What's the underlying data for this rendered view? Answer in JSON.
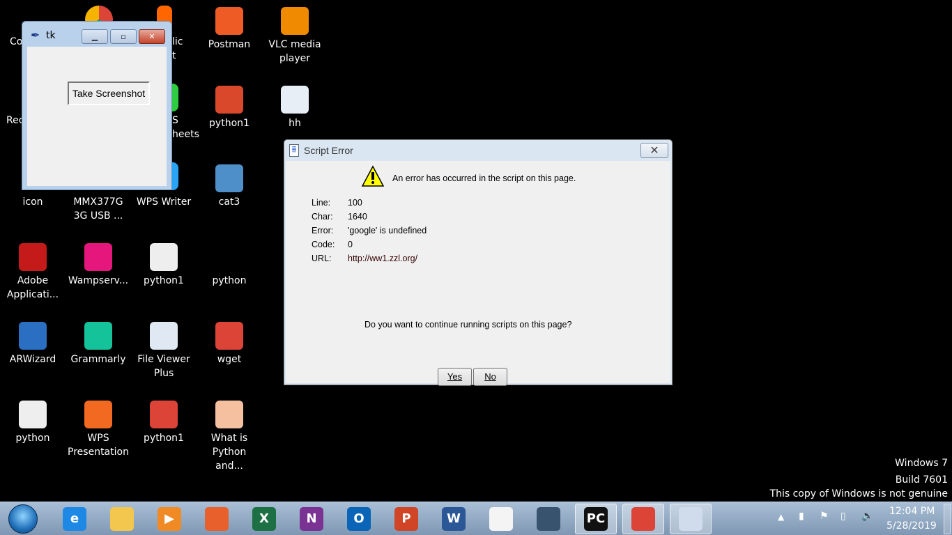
{
  "desktop": {
    "icons": [
      {
        "label": "Postman",
        "color": "#ef5b25",
        "col": 3,
        "row": 0
      },
      {
        "label": "VLC media player",
        "color": "#f08a00",
        "col": 4,
        "row": 0
      },
      {
        "label": "python1",
        "color": "#d9482b",
        "col": 3,
        "row": 1
      },
      {
        "label": "hh",
        "color": "#e8eef6",
        "col": 4,
        "row": 1
      },
      {
        "label": "icon",
        "color": "#000",
        "col": 0,
        "row": 2
      },
      {
        "label": "MMX377G 3G USB ...",
        "color": "#000",
        "col": 1,
        "row": 2
      },
      {
        "label": "WPS Writer",
        "color": "#000",
        "col": 2,
        "row": 2
      },
      {
        "label": "cat3",
        "color": "#4f8fc9",
        "col": 3,
        "row": 2
      },
      {
        "label": "Adobe Applicati...",
        "color": "#c41a1a",
        "col": 0,
        "row": 3
      },
      {
        "label": "Wampserv...",
        "color": "#e5177d",
        "col": 1,
        "row": 3
      },
      {
        "label": "python1",
        "color": "#eeeeee",
        "col": 2,
        "row": 3
      },
      {
        "label": "python",
        "color": "#000",
        "col": 3,
        "row": 3
      },
      {
        "label": "ARWizard",
        "color": "#2a6fc2",
        "col": 0,
        "row": 4
      },
      {
        "label": "Grammarly",
        "color": "#15c39a",
        "col": 1,
        "row": 4
      },
      {
        "label": "File Viewer Plus",
        "color": "#dfe8f3",
        "col": 2,
        "row": 4
      },
      {
        "label": "wget",
        "color": "#db4437",
        "col": 3,
        "row": 4
      },
      {
        "label": "python",
        "color": "#eeeeee",
        "col": 0,
        "row": 5
      },
      {
        "label": "WPS Presentation",
        "color": "#f26a21",
        "col": 1,
        "row": 5
      },
      {
        "label": "python1",
        "color": "#db4437",
        "col": 2,
        "row": 5
      },
      {
        "label": "What is Python and...",
        "color": "#f4c0a0",
        "col": 3,
        "row": 5
      }
    ],
    "fragments": {
      "computer": "Co",
      "recycle": "Rec",
      "pub1": "lic",
      "pub2": "t",
      "sheets1": "S",
      "sheets2": "heets"
    }
  },
  "tk_window": {
    "title": "tk",
    "button": "Take Screenshot"
  },
  "dialog": {
    "title": "Script Error",
    "message": "An error has occurred in the script on this page.",
    "fields": [
      {
        "k": "Line:",
        "v": "100"
      },
      {
        "k": "Char:",
        "v": "1640"
      },
      {
        "k": "Error:",
        "v": "'google' is undefined"
      },
      {
        "k": "Code:",
        "v": "0"
      },
      {
        "k": "URL:",
        "v": "http://ww1.zzl.org/"
      }
    ],
    "question": "Do you want to continue running scripts on this page?",
    "yes": "Yes",
    "no": "No"
  },
  "watermark": {
    "line1": "Windows 7",
    "line2": "Build 7601",
    "line3": "This copy of Windows is not genuine"
  },
  "taskbar": {
    "items": [
      {
        "name": "internet-explorer",
        "glyph": "e",
        "color": "#1e88e5"
      },
      {
        "name": "file-explorer",
        "glyph": "",
        "color": "#f3c64e"
      },
      {
        "name": "media-player",
        "glyph": "▶",
        "color": "#f08a24"
      },
      {
        "name": "firefox",
        "glyph": "",
        "color": "#e8602c"
      },
      {
        "name": "excel",
        "glyph": "X",
        "color": "#1d7044"
      },
      {
        "name": "onenote",
        "glyph": "N",
        "color": "#7b3393"
      },
      {
        "name": "outlook",
        "glyph": "O",
        "color": "#0a64b8"
      },
      {
        "name": "powerpoint",
        "glyph": "P",
        "color": "#d04525"
      },
      {
        "name": "word",
        "glyph": "W",
        "color": "#2b5797"
      },
      {
        "name": "document",
        "glyph": "",
        "color": "#f4f4f4"
      },
      {
        "name": "python",
        "glyph": "",
        "color": "#37536e"
      },
      {
        "name": "pycharm",
        "glyph": "PC",
        "color": "#111",
        "active": true
      },
      {
        "name": "chrome",
        "glyph": "",
        "color": "#db4437",
        "active": true
      },
      {
        "name": "tk-feather",
        "glyph": "",
        "color": "#d0dcec",
        "active": true
      }
    ]
  },
  "clock": {
    "time": "12:04 PM",
    "date": "5/28/2019"
  }
}
